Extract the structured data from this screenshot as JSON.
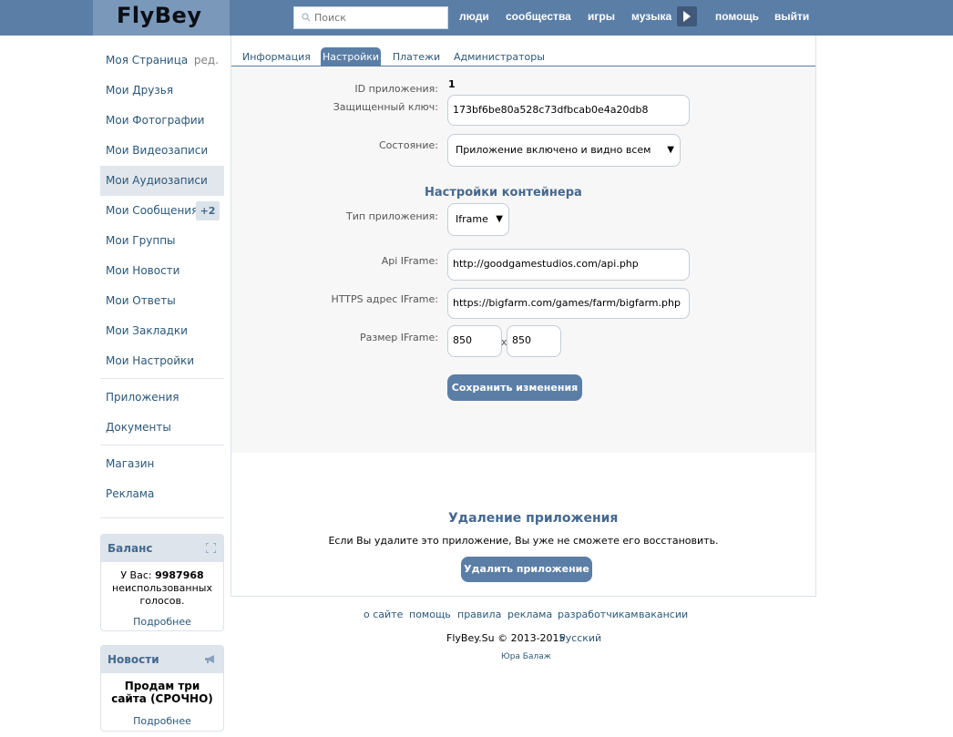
{
  "header": {
    "logo": "FlyBey",
    "search_placeholder": "Поиск",
    "nav": [
      "люди",
      "сообщества",
      "игры",
      "музыка",
      "помощь",
      "выйти"
    ]
  },
  "sidebar": {
    "items": [
      {
        "label": "Моя Страница",
        "extra": "ред."
      },
      {
        "label": "Мои Друзья"
      },
      {
        "label": "Мои Фотографии"
      },
      {
        "label": "Мои Видеозаписи"
      },
      {
        "label": "Мои Аудиозаписи"
      },
      {
        "label": "Мои Сообщения",
        "badge": "+2"
      },
      {
        "label": "Мои Группы"
      },
      {
        "label": "Мои Новости"
      },
      {
        "label": "Мои Ответы"
      },
      {
        "label": "Мои Закладки"
      },
      {
        "label": "Мои Настройки"
      },
      {
        "label": "Приложения"
      },
      {
        "label": "Документы"
      },
      {
        "label": "Магазин"
      },
      {
        "label": "Реклама"
      }
    ],
    "balance": {
      "title": "Баланс",
      "prefix": "У Вас:",
      "amount": "9987968",
      "suffix": "неиспользованных голосов.",
      "more": "Подробнее"
    },
    "news": {
      "title": "Новости",
      "headline": "Продам три сайта (СРОЧНО)",
      "more": "Подробнее"
    }
  },
  "tabs": [
    "Информация",
    "Настройки",
    "Платежи",
    "Администраторы"
  ],
  "settings": {
    "app_id_label": "ID приложения:",
    "app_id_value": "1",
    "secret_label": "Защищенный ключ:",
    "secret_value": "173bf6be80a528c73dfbcab0e4a20db8",
    "state_label": "Состояние:",
    "state_value": "Приложение включено и видно всем",
    "container_title": "Настройки контейнера",
    "type_label": "Тип приложения:",
    "type_value": "Iframe",
    "api_label": "Api IFrame:",
    "api_value": "http://goodgamestudios.com/api.php",
    "https_label": "HTTPS адрес IFrame:",
    "https_value": "https://bigfarm.com/games/farm/bigfarm.php",
    "size_label": "Размер IFrame:",
    "width_value": "850",
    "size_sep": "x",
    "height_value": "850",
    "save_button": "Сохранить изменения"
  },
  "delete": {
    "title": "Удаление приложения",
    "note": "Если Вы удалите это приложение, Вы уже не сможете его восстановить.",
    "button": "Удалить приложение"
  },
  "footer": {
    "links": [
      "о сайте",
      "помощь",
      "правила",
      "реклама",
      "разработчикам",
      "вакансии"
    ],
    "copyright": "FlyBey.Su © 2013-2015",
    "language": "Русский",
    "author": "Юра Балаж"
  },
  "colors": {
    "header": "#5b7ea6",
    "link": "#2b587a",
    "accent": "#45688e"
  }
}
